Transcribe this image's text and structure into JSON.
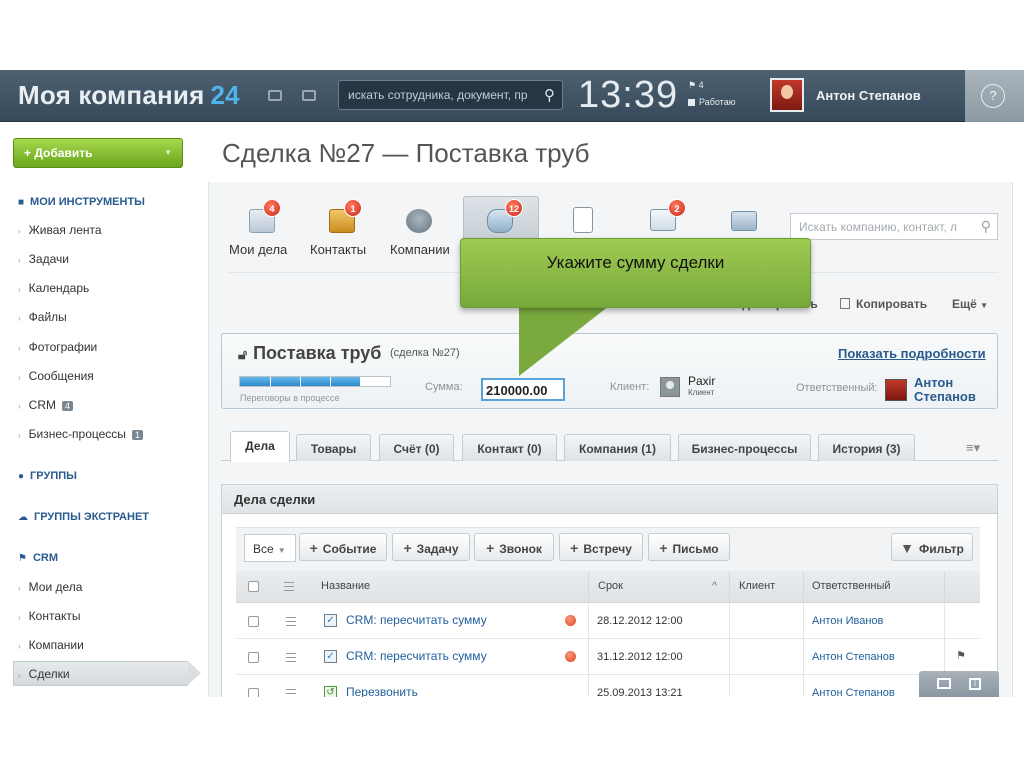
{
  "header": {
    "logo_text": "Моя компания",
    "logo_number": "24",
    "search_placeholder": "искать сотрудника, документ, пр",
    "clock": "13:39",
    "flag_count": "4",
    "work_status": "Работаю",
    "user_name": "Антон Степанов",
    "help_label": "?"
  },
  "sidebar": {
    "add_button": "Добавить",
    "sections": {
      "tools": "МОИ ИНСТРУМЕНТЫ",
      "groups": "ГРУППЫ",
      "extranet": "ГРУППЫ ЭКСТРАНЕТ",
      "crm": "CRM"
    },
    "tools_items": [
      {
        "label": "Живая лента"
      },
      {
        "label": "Задачи"
      },
      {
        "label": "Календарь"
      },
      {
        "label": "Файлы"
      },
      {
        "label": "Фотографии"
      },
      {
        "label": "Сообщения"
      },
      {
        "label": "CRM",
        "badge": "4"
      },
      {
        "label": "Бизнес-процессы",
        "badge": "1"
      }
    ],
    "crm_items": [
      {
        "label": "Мои дела"
      },
      {
        "label": "Контакты"
      },
      {
        "label": "Компании"
      },
      {
        "label": "Сделки"
      }
    ]
  },
  "page": {
    "title": "Сделка №27 — Поставка труб"
  },
  "crm_toolbar": {
    "items": [
      {
        "label": "Мои дела",
        "count": "4"
      },
      {
        "label": "Контакты",
        "count": "1"
      },
      {
        "label": "Компании",
        "count": ""
      },
      {
        "label": "",
        "count": "12"
      },
      {
        "label": "",
        "count": ""
      },
      {
        "label": "",
        "count": "2"
      },
      {
        "label": "",
        "count": ""
      }
    ],
    "search_placeholder": "Искать компанию, контакт, л",
    "actions": {
      "edit": "Редактировать",
      "copy": "Копировать",
      "more": "Ещё"
    }
  },
  "tooltip": {
    "text": "Укажите сумму сделки"
  },
  "deal": {
    "title": "Поставка труб",
    "subtitle": "(сделка №27)",
    "show_details": "Показать подробности",
    "stage": "Переговоры в процессе",
    "progress_fraction": 0.8,
    "sum_label": "Сумма:",
    "sum_value": "210000.00",
    "client_label": "Клиент:",
    "client_name": "Paxir",
    "client_type": "Клиент",
    "responsible_label": "Ответственный:",
    "responsible_name_1": "Антон",
    "responsible_name_2": "Степанов"
  },
  "tabs": [
    {
      "label": "Дела"
    },
    {
      "label": "Товары"
    },
    {
      "label": "Счёт (0)"
    },
    {
      "label": "Контакт (0)"
    },
    {
      "label": "Компания (1)"
    },
    {
      "label": "Бизнес-процессы"
    },
    {
      "label": "История (3)"
    }
  ],
  "activities": {
    "title": "Дела сделки",
    "filter_select": "Все",
    "buttons": {
      "event": "Событие",
      "task": "Задачу",
      "call": "Звонок",
      "meeting": "Встречу",
      "email": "Письмо",
      "filter": "Фильтр"
    },
    "columns": {
      "name": "Название",
      "deadline": "Срок",
      "client": "Клиент",
      "responsible": "Ответственный"
    },
    "rows": [
      {
        "name": "CRM: пересчитать сумму",
        "deadline": "28.12.2012 12:00",
        "client": "",
        "responsible": "Антон Иванов"
      },
      {
        "name": "CRM: пересчитать сумму",
        "deadline": "31.12.2012 12:00",
        "client": "",
        "responsible": "Антон Степанов"
      },
      {
        "name": "Перезвонить",
        "deadline": "25.09.2013 13:21",
        "client": "",
        "responsible": "Антон Степанов"
      }
    ]
  }
}
